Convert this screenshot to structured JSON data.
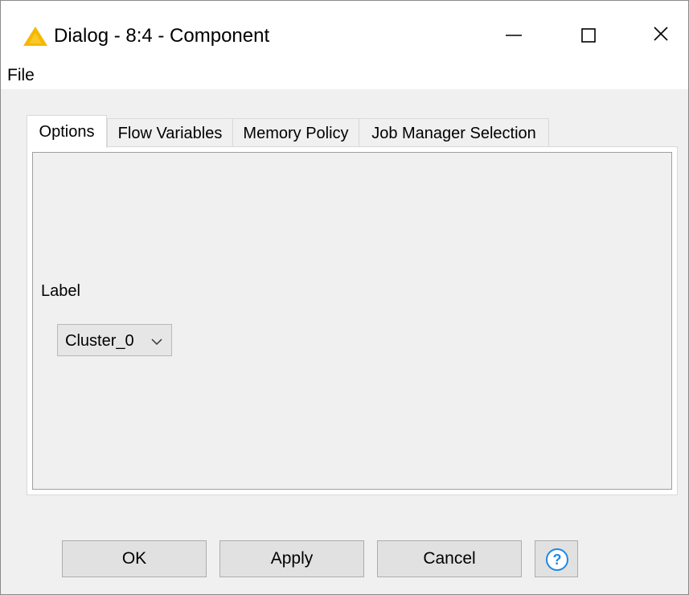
{
  "window": {
    "title": "Dialog - 8:4 - Component",
    "icon": "warning-triangle-icon",
    "accent_color": "#f5b800"
  },
  "menu": {
    "file_label": "File"
  },
  "tabs": [
    {
      "label": "Options",
      "active": true
    },
    {
      "label": "Flow Variables",
      "active": false
    },
    {
      "label": "Memory Policy",
      "active": false
    },
    {
      "label": "Job Manager Selection",
      "active": false
    }
  ],
  "options": {
    "label_text": "Label",
    "dropdown_value": "Cluster_0"
  },
  "buttons": {
    "ok": "OK",
    "apply": "Apply",
    "cancel": "Cancel",
    "help_icon": "help-circle-icon",
    "help_color": "#1e88e5"
  }
}
